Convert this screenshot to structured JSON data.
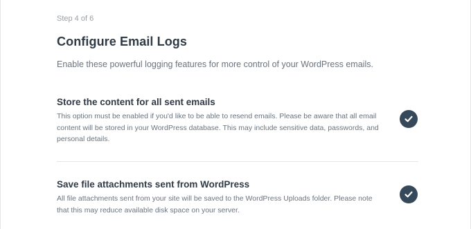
{
  "wizard": {
    "step_label": "Step 4 of 6",
    "title": "Configure Email Logs",
    "subtitle": "Enable these powerful logging features for more control of your WordPress emails."
  },
  "options": [
    {
      "title": "Store the content for all sent emails",
      "description": "This option must be enabled if you'd like to be able to resend emails. Please be aware that all email content will be stored in your WordPress database. This may include sensitive data, passwords, and personal details.",
      "enabled": true,
      "toggle_icon": "checkmark-icon"
    },
    {
      "title": "Save file attachments sent from WordPress",
      "description": "All file attachments sent from your site will be saved to the WordPress Uploads folder. Please note that this may reduce available disk space on your server.",
      "enabled": true,
      "toggle_icon": "checkmark-icon"
    }
  ],
  "colors": {
    "toggle_on": "#36495a",
    "heading": "#2f3a45",
    "body_text": "#6a737d",
    "step_text": "#9a9fa5"
  }
}
